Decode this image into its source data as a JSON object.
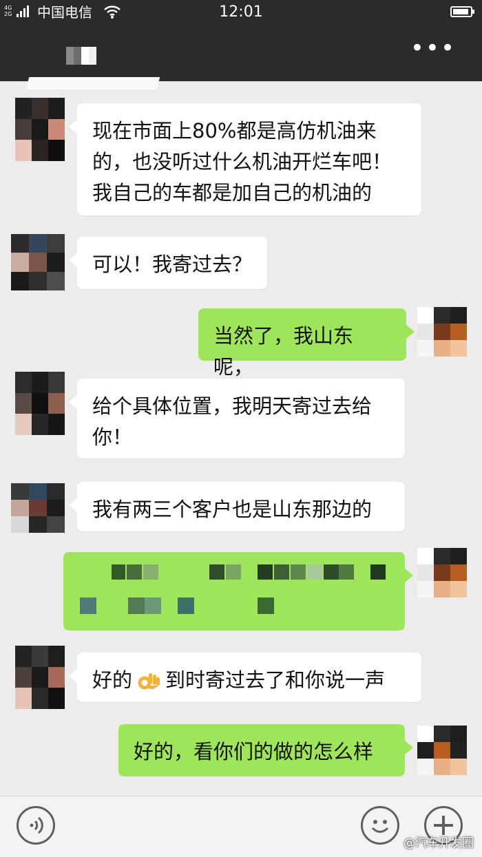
{
  "status_bar": {
    "network_type_top": "4G",
    "network_type_bottom": "2G",
    "carrier": "中国电信",
    "time": "12:01",
    "battery_level": 0.85
  },
  "header": {
    "more_icon": "more-icon"
  },
  "messages": [
    {
      "side": "left",
      "text": "现在市面上80%都是高仿机油来的，也没听过什么机油开烂车吧！我自己的车都是加自己的机油的"
    },
    {
      "side": "left",
      "text": "可以！我寄过去？"
    },
    {
      "side": "right",
      "text": "当然了，我山东呢，"
    },
    {
      "side": "left",
      "text": "给个具体位置，我明天寄过去给你！"
    },
    {
      "side": "left",
      "text": "我有两三个客户也是山东那边的"
    },
    {
      "side": "right",
      "text": "",
      "redacted": true
    },
    {
      "side": "left",
      "text_before": "好的",
      "emoji": "ok-hand-emoji",
      "text_after": "到时寄过去了和你说一声"
    },
    {
      "side": "right",
      "text": "好的，看你们的做的怎么样"
    }
  ],
  "input_bar": {
    "voice_icon": "voice-icon",
    "emoji_icon": "emoji-face-icon",
    "plus_icon": "plus-icon"
  },
  "watermark": "@汽车开发圈",
  "colors": {
    "header_bg": "#2b2b2b",
    "chat_bg": "#ececec",
    "sent_bubble": "#9fe55b",
    "received_bubble": "#ffffff"
  }
}
